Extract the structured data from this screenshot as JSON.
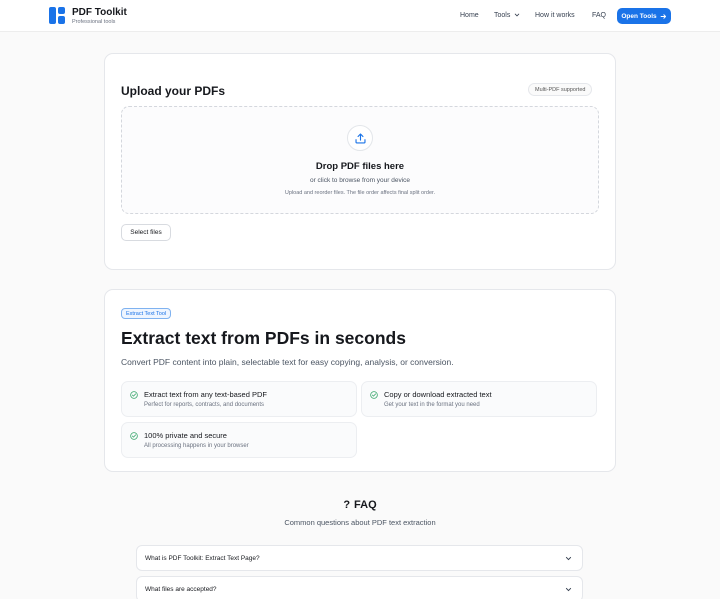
{
  "header": {
    "brand_title": "PDF Toolkit",
    "brand_subtitle": "Professional tools",
    "nav": {
      "home": "Home",
      "tools": "Tools",
      "how": "How it works",
      "faq": "FAQ"
    },
    "cta_label": "Open Tools"
  },
  "upload": {
    "title": "Upload your PDFs",
    "pill": "Multi-PDF supported",
    "drop_title": "Drop PDF files here",
    "drop_subtitle": "or click to browse from your device",
    "drop_hint": "Upload and reorder files. The file order affects final split order.",
    "select_button": "Select files"
  },
  "extract": {
    "badge": "Extract Text Tool",
    "title": "Extract text from PDFs in seconds",
    "subtitle": "Convert PDF content into plain, selectable text for easy copying, analysis, or conversion.",
    "features": [
      {
        "title": "Extract text from any text-based PDF",
        "desc": "Perfect for reports, contracts, and documents"
      },
      {
        "title": "Copy or download extracted text",
        "desc": "Get your text in the format you need"
      },
      {
        "title": "100% private and secure",
        "desc": "All processing happens in your browser"
      }
    ]
  },
  "faq": {
    "icon": "?",
    "title": "FAQ",
    "subtitle": "Common questions about PDF text extraction",
    "items": [
      "What is PDF Toolkit: Extract Text Page?",
      "What files are accepted?"
    ]
  },
  "colors": {
    "accent": "#1a73e8",
    "check": "#3aa76d"
  }
}
